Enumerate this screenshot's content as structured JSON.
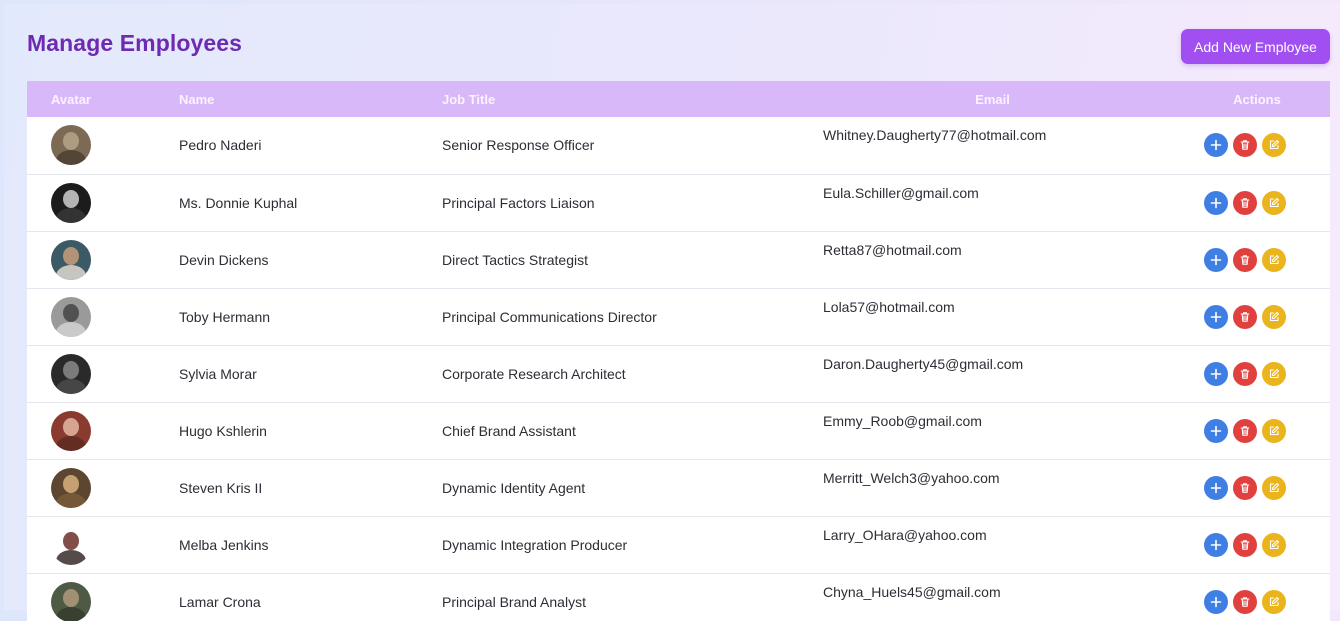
{
  "header": {
    "title": "Manage Employees",
    "add_button_label": "Add New Employee"
  },
  "table": {
    "columns": [
      "Avatar",
      "Name",
      "Job Title",
      "Email",
      "Actions"
    ],
    "rows": [
      {
        "name": "Pedro Naderi",
        "job_title": "Senior Response Officer",
        "email": "Whitney.Daugherty77@hotmail.com",
        "avatar_colors": [
          "#7d6a55",
          "#b5a48a",
          "#4a3d30"
        ]
      },
      {
        "name": "Ms. Donnie Kuphal",
        "job_title": "Principal Factors Liaison",
        "email": "Eula.Schiller@gmail.com",
        "avatar_colors": [
          "#1c1c1c",
          "#cfcfcf",
          "#3a3a3a"
        ]
      },
      {
        "name": "Devin Dickens",
        "job_title": "Direct Tactics Strategist",
        "email": "Retta87@hotmail.com",
        "avatar_colors": [
          "#3c5a66",
          "#c89d7a",
          "#e8e0d6"
        ]
      },
      {
        "name": "Toby Hermann",
        "job_title": "Principal Communications Director",
        "email": "Lola57@hotmail.com",
        "avatar_colors": [
          "#9a9a9a",
          "#444444",
          "#d6d6d6"
        ]
      },
      {
        "name": "Sylvia Morar",
        "job_title": "Corporate Research Architect",
        "email": "Daron.Daugherty45@gmail.com",
        "avatar_colors": [
          "#2a2a2a",
          "#8a8a8a",
          "#4d4d4d"
        ]
      },
      {
        "name": "Hugo Kshlerin",
        "job_title": "Chief Brand Assistant",
        "email": "Emmy_Roob@gmail.com",
        "avatar_colors": [
          "#8a3a2e",
          "#e3b9a3",
          "#5a2a22"
        ]
      },
      {
        "name": "Steven Kris II",
        "job_title": "Dynamic Identity Agent",
        "email": "Merritt_Welch3@yahoo.com",
        "avatar_colors": [
          "#5d4630",
          "#d8b07c",
          "#7b5c3a"
        ]
      },
      {
        "name": "Melba Jenkins",
        "job_title": "Dynamic Integration Producer",
        "email": "Larry_OHara@yahoo.com",
        "avatar_colors": [
          "#ffffff",
          "#6b2f2a",
          "#2a1f1d"
        ]
      },
      {
        "name": "Lamar Crona",
        "job_title": "Principal Brand Analyst",
        "email": "Chyna_Huels45@gmail.com",
        "avatar_colors": [
          "#4e5a44",
          "#b09a7c",
          "#353a2c"
        ]
      }
    ]
  },
  "colors": {
    "title": "#6f2ab3",
    "accent_button": "#a14ff0",
    "header_row": "#d9b8fa",
    "add_action": "#3f7fe4",
    "delete_action": "#e0413f",
    "edit_action": "#eab41d"
  },
  "row_action_icons": [
    "plus-icon",
    "trash-icon",
    "edit-icon"
  ]
}
